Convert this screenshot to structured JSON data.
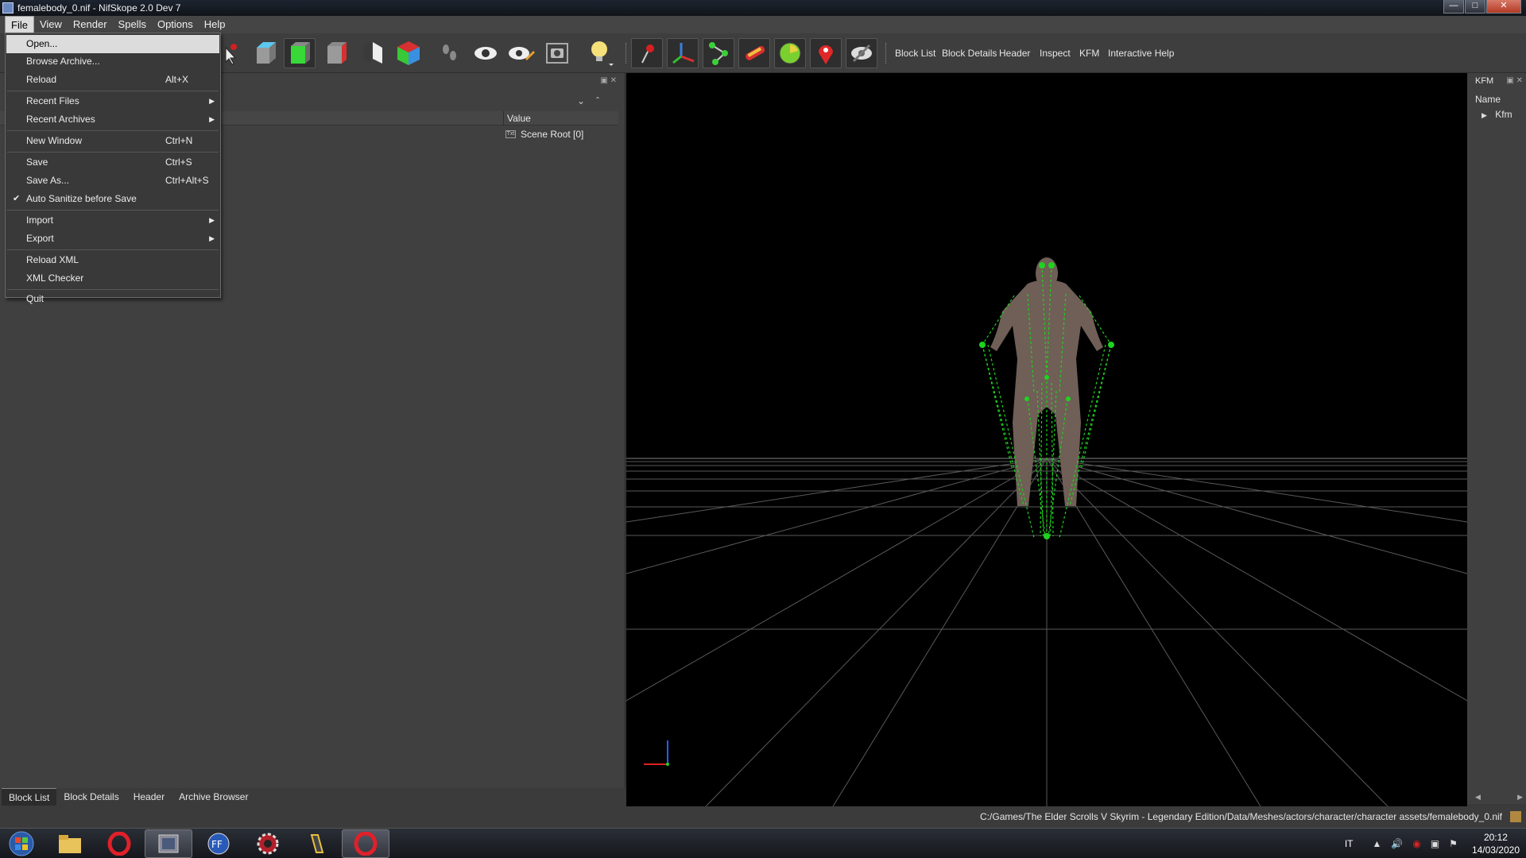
{
  "window": {
    "title": "femalebody_0.nif - NifSkope 2.0 Dev 7"
  },
  "menubar": {
    "items": [
      "File",
      "View",
      "Render",
      "Spells",
      "Options",
      "Help"
    ]
  },
  "toolbar": {
    "dock_toggles": [
      "Block List",
      "Block Details",
      "Header",
      "Inspect",
      "KFM",
      "Interactive Help"
    ]
  },
  "file_menu": {
    "items": [
      {
        "label": "Open...",
        "shortcut": ""
      },
      {
        "label": "Browse Archive...",
        "shortcut": ""
      },
      {
        "label": "Reload",
        "shortcut": "Alt+X"
      },
      {
        "label": "Recent Files",
        "shortcut": ""
      },
      {
        "label": "Recent Archives",
        "shortcut": ""
      },
      {
        "label": "New Window",
        "shortcut": "Ctrl+N"
      },
      {
        "label": "Save",
        "shortcut": "Ctrl+S"
      },
      {
        "label": "Save As...",
        "shortcut": "Ctrl+Alt+S"
      },
      {
        "label": "Auto Sanitize before Save",
        "shortcut": "",
        "checked": true
      },
      {
        "label": "Import",
        "shortcut": ""
      },
      {
        "label": "Export",
        "shortcut": ""
      },
      {
        "label": "Reload XML",
        "shortcut": ""
      },
      {
        "label": "XML Checker",
        "shortcut": ""
      },
      {
        "label": "Quit",
        "shortcut": ""
      }
    ]
  },
  "block_list": {
    "value_header": "Value",
    "rows": [
      {
        "value": "Scene Root [0]"
      }
    ]
  },
  "kfm_panel": {
    "title": "KFM",
    "name_header": "Name",
    "items": [
      "Kfm"
    ]
  },
  "bottom_tabs": [
    "Block List",
    "Block Details",
    "Header",
    "Archive Browser"
  ],
  "status": {
    "path": "C:/Games/The Elder Scrolls V Skyrim - Legendary Edition/Data/Meshes/actors/character/character assets/femalebody_0.nif"
  },
  "tray": {
    "language": "IT",
    "time": "20:12",
    "date": "14/03/2020"
  },
  "colors": {
    "skeleton": "#1fd31f",
    "body": "#6f5f56",
    "viewport_bg": "#000000"
  }
}
